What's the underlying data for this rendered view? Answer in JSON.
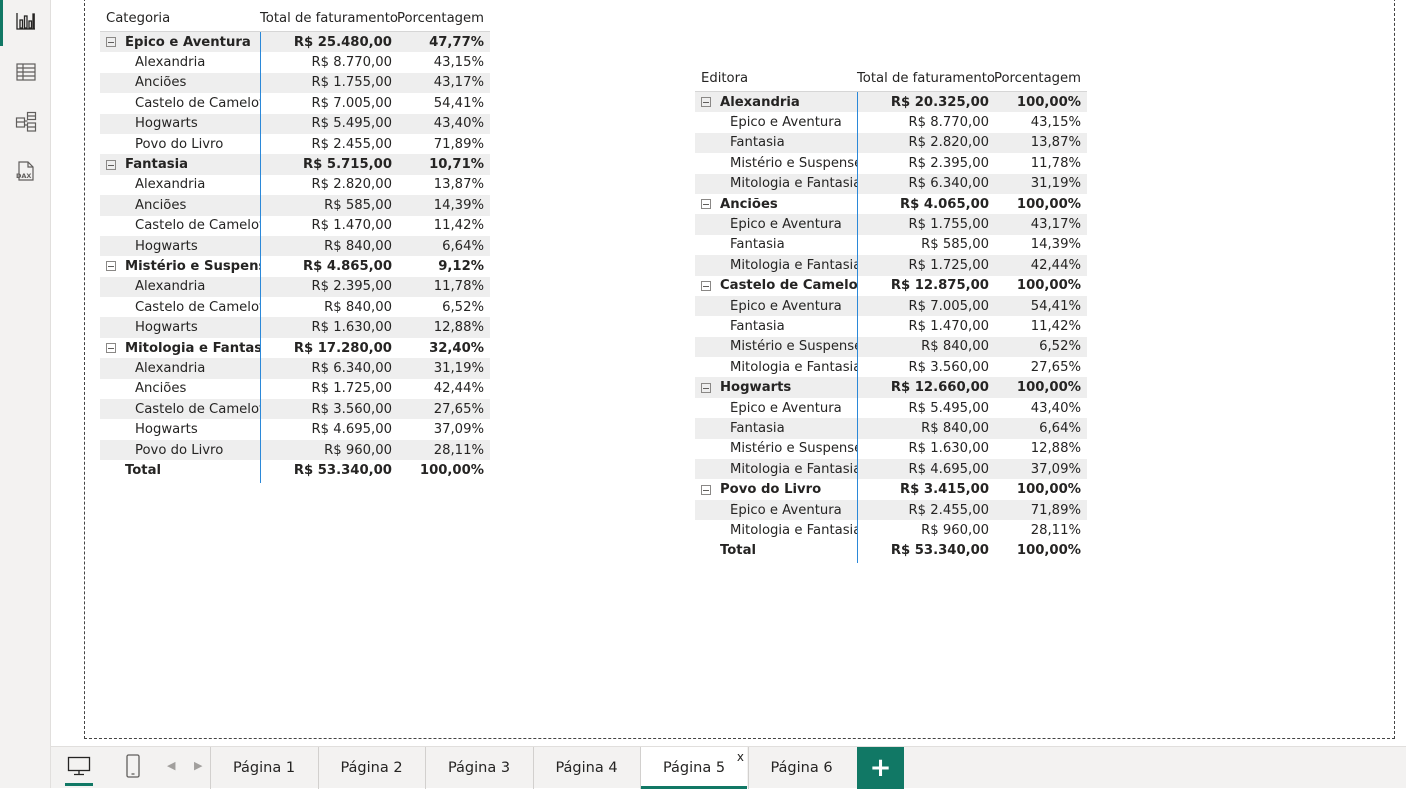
{
  "rail": {
    "items": [
      {
        "name": "report-view",
        "icon": "bar-chart-icon"
      },
      {
        "name": "data-view",
        "icon": "table-grid-icon"
      },
      {
        "name": "model-view",
        "icon": "model-diagram-icon"
      },
      {
        "name": "dax-view",
        "icon": "dax-query-icon",
        "label": "DAX"
      }
    ]
  },
  "matrix1": {
    "headers": [
      "Categoria",
      "Total de faturamento",
      "Porcentagem"
    ],
    "rows": [
      {
        "label": "Épico e Aventura",
        "total": "R$ 25.480,00",
        "pct": "47,77%",
        "level": 0
      },
      {
        "label": "Alexandria",
        "total": "R$ 8.770,00",
        "pct": "43,15%",
        "level": 1
      },
      {
        "label": "Anciões",
        "total": "R$ 1.755,00",
        "pct": "43,17%",
        "level": 1
      },
      {
        "label": "Castelo de Camelot",
        "total": "R$ 7.005,00",
        "pct": "54,41%",
        "level": 1
      },
      {
        "label": "Hogwarts",
        "total": "R$ 5.495,00",
        "pct": "43,40%",
        "level": 1
      },
      {
        "label": "Povo do Livro",
        "total": "R$ 2.455,00",
        "pct": "71,89%",
        "level": 1
      },
      {
        "label": "Fantasia",
        "total": "R$ 5.715,00",
        "pct": "10,71%",
        "level": 0
      },
      {
        "label": "Alexandria",
        "total": "R$ 2.820,00",
        "pct": "13,87%",
        "level": 1
      },
      {
        "label": "Anciões",
        "total": "R$ 585,00",
        "pct": "14,39%",
        "level": 1
      },
      {
        "label": "Castelo de Camelot",
        "total": "R$ 1.470,00",
        "pct": "11,42%",
        "level": 1
      },
      {
        "label": "Hogwarts",
        "total": "R$ 840,00",
        "pct": "6,64%",
        "level": 1
      },
      {
        "label": "Mistério e Suspense",
        "total": "R$ 4.865,00",
        "pct": "9,12%",
        "level": 0
      },
      {
        "label": "Alexandria",
        "total": "R$ 2.395,00",
        "pct": "11,78%",
        "level": 1
      },
      {
        "label": "Castelo de Camelot",
        "total": "R$ 840,00",
        "pct": "6,52%",
        "level": 1
      },
      {
        "label": "Hogwarts",
        "total": "R$ 1.630,00",
        "pct": "12,88%",
        "level": 1
      },
      {
        "label": "Mitologia e Fantasia",
        "total": "R$ 17.280,00",
        "pct": "32,40%",
        "level": 0
      },
      {
        "label": "Alexandria",
        "total": "R$ 6.340,00",
        "pct": "31,19%",
        "level": 1
      },
      {
        "label": "Anciões",
        "total": "R$ 1.725,00",
        "pct": "42,44%",
        "level": 1
      },
      {
        "label": "Castelo de Camelot",
        "total": "R$ 3.560,00",
        "pct": "27,65%",
        "level": 1
      },
      {
        "label": "Hogwarts",
        "total": "R$ 4.695,00",
        "pct": "37,09%",
        "level": 1
      },
      {
        "label": "Povo do Livro",
        "total": "R$ 960,00",
        "pct": "28,11%",
        "level": 1
      }
    ],
    "total": {
      "label": "Total",
      "total": "R$ 53.340,00",
      "pct": "100,00%"
    }
  },
  "matrix2": {
    "headers": [
      "Editora",
      "Total de faturamento",
      "Porcentagem"
    ],
    "rows": [
      {
        "label": "Alexandria",
        "total": "R$ 20.325,00",
        "pct": "100,00%",
        "level": 0
      },
      {
        "label": "Épico e Aventura",
        "total": "R$ 8.770,00",
        "pct": "43,15%",
        "level": 1
      },
      {
        "label": "Fantasia",
        "total": "R$ 2.820,00",
        "pct": "13,87%",
        "level": 1
      },
      {
        "label": "Mistério e Suspense",
        "total": "R$ 2.395,00",
        "pct": "11,78%",
        "level": 1
      },
      {
        "label": "Mitologia e Fantasia",
        "total": "R$ 6.340,00",
        "pct": "31,19%",
        "level": 1
      },
      {
        "label": "Anciões",
        "total": "R$ 4.065,00",
        "pct": "100,00%",
        "level": 0
      },
      {
        "label": "Épico e Aventura",
        "total": "R$ 1.755,00",
        "pct": "43,17%",
        "level": 1
      },
      {
        "label": "Fantasia",
        "total": "R$ 585,00",
        "pct": "14,39%",
        "level": 1
      },
      {
        "label": "Mitologia e Fantasia",
        "total": "R$ 1.725,00",
        "pct": "42,44%",
        "level": 1
      },
      {
        "label": "Castelo de Camelot",
        "total": "R$ 12.875,00",
        "pct": "100,00%",
        "level": 0
      },
      {
        "label": "Épico e Aventura",
        "total": "R$ 7.005,00",
        "pct": "54,41%",
        "level": 1
      },
      {
        "label": "Fantasia",
        "total": "R$ 1.470,00",
        "pct": "11,42%",
        "level": 1
      },
      {
        "label": "Mistério e Suspense",
        "total": "R$ 840,00",
        "pct": "6,52%",
        "level": 1
      },
      {
        "label": "Mitologia e Fantasia",
        "total": "R$ 3.560,00",
        "pct": "27,65%",
        "level": 1
      },
      {
        "label": "Hogwarts",
        "total": "R$ 12.660,00",
        "pct": "100,00%",
        "level": 0
      },
      {
        "label": "Épico e Aventura",
        "total": "R$ 5.495,00",
        "pct": "43,40%",
        "level": 1
      },
      {
        "label": "Fantasia",
        "total": "R$ 840,00",
        "pct": "6,64%",
        "level": 1
      },
      {
        "label": "Mistério e Suspense",
        "total": "R$ 1.630,00",
        "pct": "12,88%",
        "level": 1
      },
      {
        "label": "Mitologia e Fantasia",
        "total": "R$ 4.695,00",
        "pct": "37,09%",
        "level": 1
      },
      {
        "label": "Povo do Livro",
        "total": "R$ 3.415,00",
        "pct": "100,00%",
        "level": 0
      },
      {
        "label": "Épico e Aventura",
        "total": "R$ 2.455,00",
        "pct": "71,89%",
        "level": 1
      },
      {
        "label": "Mitologia e Fantasia",
        "total": "R$ 960,00",
        "pct": "28,11%",
        "level": 1
      }
    ],
    "total": {
      "label": "Total",
      "total": "R$ 53.340,00",
      "pct": "100,00%"
    }
  },
  "tabs": {
    "pages": [
      "Página 1",
      "Página 2",
      "Página 3",
      "Página 4",
      "Página 5",
      "Página 6"
    ],
    "active_index": 4,
    "close_label": "x",
    "add_label": "+"
  },
  "colors": {
    "accent": "#117865",
    "divider": "#2b88d8",
    "band": "#eeeeee"
  }
}
